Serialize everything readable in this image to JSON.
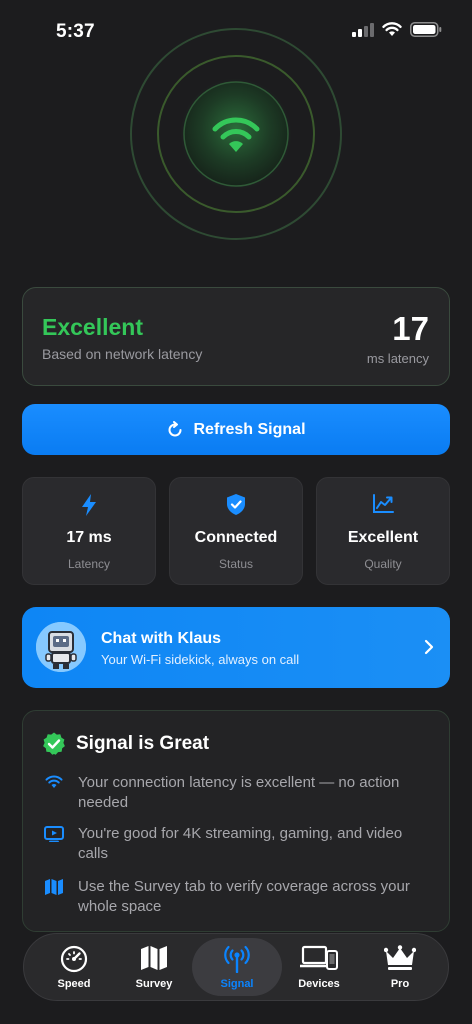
{
  "status_bar": {
    "time": "5:37"
  },
  "signal_card": {
    "quality": "Excellent",
    "subtitle": "Based on network latency",
    "value": "17",
    "unit": "ms latency"
  },
  "refresh_button": {
    "label": "Refresh Signal"
  },
  "stats": [
    {
      "value": "17 ms",
      "label": "Latency",
      "icon": "bolt-icon"
    },
    {
      "value": "Connected",
      "label": "Status",
      "icon": "shield-check-icon"
    },
    {
      "value": "Excellent",
      "label": "Quality",
      "icon": "chart-line-icon"
    }
  ],
  "chat": {
    "title": "Chat with Klaus",
    "subtitle": "Your Wi-Fi sidekick, always on call"
  },
  "great_card": {
    "title": "Signal is Great",
    "tips": [
      {
        "icon": "wifi-icon",
        "text": "Your connection latency is excellent — no action needed"
      },
      {
        "icon": "tv-play-icon",
        "text": "You're good for 4K streaming, gaming, and video calls"
      },
      {
        "icon": "map-icon",
        "text": "Use the Survey tab to verify coverage across your whole space"
      }
    ]
  },
  "tabbar": {
    "tabs": [
      {
        "label": "Speed",
        "icon": "speedometer-icon"
      },
      {
        "label": "Survey",
        "icon": "map-icon"
      },
      {
        "label": "Signal",
        "icon": "antenna-icon",
        "active": true
      },
      {
        "label": "Devices",
        "icon": "devices-icon"
      },
      {
        "label": "Pro",
        "icon": "crown-icon"
      }
    ]
  },
  "colors": {
    "background": "#1c1c1e",
    "accent_green": "#34c759",
    "accent_blue": "#0a84ff",
    "card": "#2a2a2d"
  }
}
